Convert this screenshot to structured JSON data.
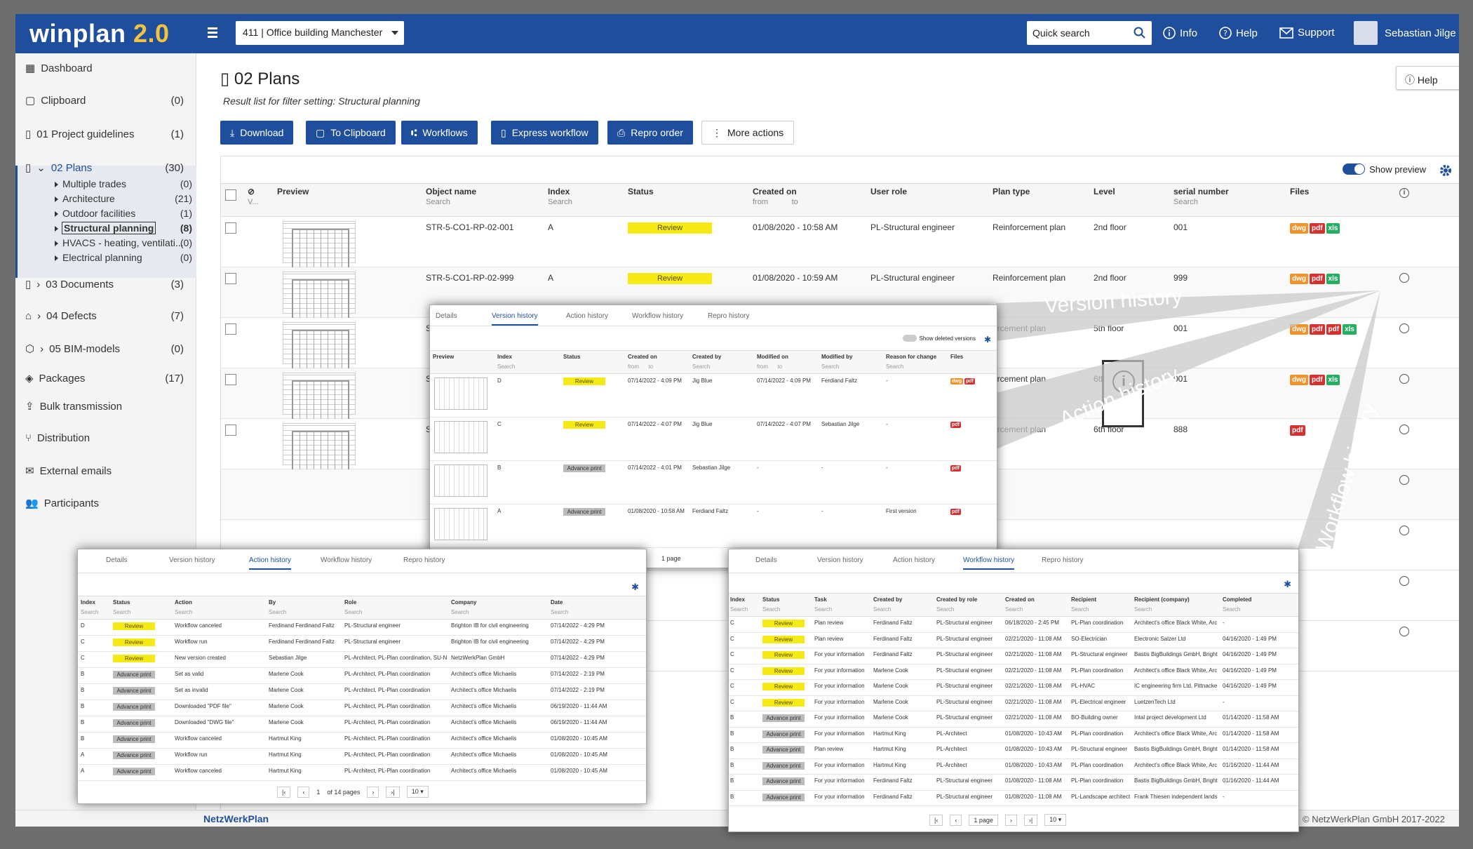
{
  "topbar": {
    "logo_main": "winplan",
    "logo_version": "2.0",
    "project": "411 | Office building Manchester",
    "search_placeholder": "Quick search",
    "info": "Info",
    "help": "Help",
    "support": "Support",
    "user": "Sebastian Jilge"
  },
  "sidebar": {
    "items": [
      {
        "label": "Dashboard",
        "count": ""
      },
      {
        "label": "Clipboard",
        "count": "(0)"
      },
      {
        "label": "01 Project guidelines",
        "count": "(1)"
      },
      {
        "label": "02 Plans",
        "count": "(30)"
      },
      {
        "label": "03 Documents",
        "count": "(3)"
      },
      {
        "label": "04 Defects",
        "count": "(7)"
      },
      {
        "label": "05 BIM-models",
        "count": "(0)"
      },
      {
        "label": "Packages",
        "count": "(17)"
      },
      {
        "label": "Bulk transmission",
        "count": ""
      },
      {
        "label": "Distribution",
        "count": ""
      },
      {
        "label": "External emails",
        "count": ""
      },
      {
        "label": "Participants",
        "count": ""
      }
    ],
    "plans_sub": [
      {
        "label": "Multiple trades",
        "count": "(0)"
      },
      {
        "label": "Architecture",
        "count": "(21)"
      },
      {
        "label": "Outdoor facilities",
        "count": "(1)"
      },
      {
        "label": "Structural planning",
        "count": "(8)"
      },
      {
        "label": "HVACS - heating, ventilati...",
        "count": "(0)"
      },
      {
        "label": "Electrical planning",
        "count": "(0)"
      }
    ]
  },
  "page": {
    "title": "02 Plans",
    "subtitle": "Result list for filter setting: Structural planning",
    "help": "Help"
  },
  "toolbar": {
    "download": "Download",
    "clipboard": "To Clipboard",
    "workflows": "Workflows",
    "express": "Express workflow",
    "repro": "Repro order",
    "more": "More actions"
  },
  "grid": {
    "show_preview": "Show preview",
    "headers": {
      "preview": "Preview",
      "object": "Object name",
      "index": "Index",
      "status": "Status",
      "created": "Created on",
      "role": "User role",
      "type": "Plan type",
      "level": "Level",
      "serial": "serial number",
      "files": "Files"
    },
    "search": "Search",
    "from": "from",
    "to": "to",
    "v": "V...",
    "rows": [
      {
        "object": "STR-5-CO1-RP-02-001",
        "index": "A",
        "status": "Review",
        "created": "01/08/2020 - 10:58 AM",
        "role": "PL-Structural engineer",
        "type": "Reinforcement plan",
        "level": "2nd floor",
        "serial": "001",
        "files": [
          "dwg",
          "pdf",
          "xls"
        ]
      },
      {
        "object": "STR-5-CO1-RP-02-999",
        "index": "A",
        "status": "Review",
        "created": "01/08/2020 - 10:59 AM",
        "role": "PL-Structural engineer",
        "type": "Reinforcement plan",
        "level": "2nd floor",
        "serial": "999",
        "files": [
          "dwg",
          "pdf",
          "xls"
        ]
      },
      {
        "object": "STR-",
        "type": "orcement plan",
        "level": "5th floor",
        "serial": "001",
        "files": [
          "dwg",
          "pdf",
          "pdf",
          "xls"
        ]
      },
      {
        "object": "STR-",
        "type": "orcement plan",
        "level": "6th floor",
        "serial": "001",
        "files": [
          "dwg",
          "pdf",
          "xls"
        ]
      },
      {
        "object": "STR-",
        "type": "orcement plan",
        "level": "6th floor",
        "serial": "888",
        "files": [
          "pdf"
        ]
      }
    ],
    "adv_label": "Advance print"
  },
  "fan_labels": {
    "version": "Version history",
    "action": "Action history",
    "workflow": "Workflow history"
  },
  "tabs": [
    "Details",
    "Version history",
    "Action history",
    "Workflow history",
    "Repro history"
  ],
  "version_panel": {
    "show_deleted": "Show deleted versions",
    "headers": [
      "Preview",
      "Index",
      "Status",
      "Created on",
      "Created by",
      "Modified on",
      "Modified by",
      "Reason for change",
      "Files"
    ],
    "rows": [
      {
        "index": "D",
        "status": "Review",
        "created": "07/14/2022 - 4:09 PM",
        "by": "Jig Blue",
        "mod": "07/14/2022 - 4:09 PM",
        "modby": "Ferdiand Faltz",
        "reason": "-",
        "files": [
          "dwg",
          "pdf"
        ]
      },
      {
        "index": "C",
        "status": "Review",
        "created": "07/14/2022 - 4:07 PM",
        "by": "Jig Blue",
        "mod": "07/14/2022 - 4:07 PM",
        "modby": "Sebastian Jilge",
        "reason": "-",
        "files": [
          "pdf"
        ]
      },
      {
        "index": "B",
        "status": "Advance print",
        "created": "07/14/2022 - 4:01 PM",
        "by": "Sebastian Jilge",
        "mod": "-",
        "modby": "-",
        "reason": "-",
        "files": [
          "pdf"
        ]
      },
      {
        "index": "A",
        "status": "Advance print",
        "created": "01/08/2020 - 10:58 AM",
        "by": "Ferdiand Faltz",
        "mod": "-",
        "modby": "-",
        "reason": "First version",
        "files": [
          "pdf"
        ]
      }
    ],
    "pager": "1 page"
  },
  "action_panel": {
    "headers": [
      "Index",
      "Status",
      "Action",
      "By",
      "Role",
      "Company",
      "Date"
    ],
    "rows": [
      [
        "D",
        "Review",
        "Workflow canceled",
        "Ferdinand Ferdinand Faltz",
        "PL-Structural engineer",
        "Brighton IB for civil engineering",
        "07/14/2022 - 4:29 PM"
      ],
      [
        "C",
        "Review",
        "Workflow run",
        "Ferdinand Ferdinand Faltz",
        "PL-Structural engineer",
        "Brighton IB for civil engineering",
        "07/14/2022 - 4:29 PM"
      ],
      [
        "C",
        "Review",
        "New version created",
        "Sebastian Jilge",
        "PL-Architect, PL-Plan coordination, SU-N",
        "NetzWerkPlan GmbH",
        "07/14/2022 - 4:29 PM"
      ],
      [
        "B",
        "Advance print",
        "Set as valid",
        "Marlene Cook",
        "PL-Architect, PL-Plan coordination",
        "Architect's office Michaelis",
        "07/14/2022 - 2:19 PM"
      ],
      [
        "B",
        "Advance print",
        "Set as invalid",
        "Marlene Cook",
        "PL-Architect, PL-Plan coordination",
        "Architect's office Michaelis",
        "07/14/2022 - 2:19 PM"
      ],
      [
        "B",
        "Advance print",
        "Downloaded \"PDF file\"",
        "Marlene Cook",
        "PL-Architect, PL-Plan coordination",
        "Architect's office Michaelis",
        "06/19/2020 - 11:44 AM"
      ],
      [
        "B",
        "Advance print",
        "Downloaded \"DWG file\"",
        "Marlene Cook",
        "PL-Architect, PL-Plan coordination",
        "Architect's office Michaelis",
        "06/19/2020 - 11:44 AM"
      ],
      [
        "B",
        "Advance print",
        "Workflow canceled",
        "Hartmut King",
        "PL-Architect, PL-Plan coordination",
        "Architect's office Michaelis",
        "01/08/2020 - 10:45 AM"
      ],
      [
        "A",
        "Advance print",
        "Workflow run",
        "Hartmut King",
        "PL-Architect, PL-Plan coordination",
        "Architect's office Michaelis",
        "01/08/2020 - 10:45 AM"
      ],
      [
        "A",
        "Advance print",
        "Workflow canceled",
        "Hartmut King",
        "PL-Architect, PL-Plan coordination",
        "Architect's office Michaelis",
        "01/08/2020 - 10:45 AM"
      ]
    ],
    "pager": "1",
    "pager_of": "of 14 pages",
    "per_page": "10"
  },
  "workflow_panel": {
    "headers": [
      "Index",
      "Status",
      "Task",
      "Created by",
      "Created by role",
      "Created on",
      "Recipient",
      "Recipient (company)",
      "Completed"
    ],
    "rows": [
      [
        "C",
        "Review",
        "Plan review",
        "Ferdinand Faltz",
        "PL-Structural engineer",
        "06/18/2020 - 2:45 PM",
        "PL-Plan coordination",
        "Architect's office Black White, Arc",
        "-"
      ],
      [
        "C",
        "Review",
        "Plan review",
        "Ferdinand Faltz",
        "PL-Structural engineer",
        "02/21/2020 - 11:08 AM",
        "SO-Electrician",
        "Electronic Salzer Ltd",
        "04/16/2020 - 1:49 PM"
      ],
      [
        "C",
        "Review",
        "For your information",
        "Ferdinand Faltz",
        "PL-Structural engineer",
        "02/21/2020 - 11:08 AM",
        "PL-Structural engineer",
        "Bastis BigBuildings GmbH, Bright",
        "04/16/2020 - 1:49 PM"
      ],
      [
        "C",
        "Review",
        "For your information",
        "Marlene Cook",
        "PL-Structural engineer",
        "02/21/2020 - 11:08 AM",
        "PL-Plan coordination",
        "Architect's office Black White, Arc",
        "04/16/2020 - 1:49 PM"
      ],
      [
        "C",
        "Review",
        "For your information",
        "Marlene Cook",
        "PL-Structural engineer",
        "02/21/2020 - 11:08 AM",
        "PL-HVAC",
        "IC engineering firm Ltd, Pittnacke",
        "04/16/2020 - 1:49 PM"
      ],
      [
        "C",
        "Review",
        "For your information",
        "Marlene Cook",
        "PL-Structural engineer",
        "02/21/2020 - 11:08 AM",
        "PL-Electrical engineer",
        "LuetzenTech Ltd",
        "-"
      ],
      [
        "B",
        "Advance print",
        "For your information",
        "Marlene Cook",
        "PL-Structural engineer",
        "02/21/2020 - 11:08 AM",
        "BO-Building owner",
        "Intal project development Ltd",
        "01/14/2020 - 11:58 AM"
      ],
      [
        "B",
        "Advance print",
        "For your information",
        "Hartmut King",
        "PL-Architect",
        "01/08/2020 - 10:43 AM",
        "PL-Plan coordination",
        "Architect's office Black White, Arc",
        "01/14/2020 - 11:58 AM"
      ],
      [
        "B",
        "Advance print",
        "Plan review",
        "Hartmut King",
        "PL-Architect",
        "01/08/2020 - 10:43 AM",
        "PL-Structural engineer",
        "Bastis BigBuildings GmbH, Bright",
        "01/14/2020 - 11:58 AM"
      ],
      [
        "B",
        "Advance print",
        "For your information",
        "Hartmut King",
        "PL-Architect",
        "01/08/2020 - 10:43 AM",
        "PL-Plan coordination",
        "Architect's office Black White, Arc",
        "01/16/2020 - 11:44 AM"
      ],
      [
        "B",
        "Advance print",
        "For your information",
        "Ferdinand Faltz",
        "PL-Structural engineer",
        "01/08/2020 - 11:08 AM",
        "PL-Plan coordination",
        "Bastis BigBuildings GmbH, Bright",
        "01/16/2020 - 11:44 AM"
      ],
      [
        "B",
        "Advance print",
        "For your information",
        "Ferdinand Faltz",
        "PL-Structural engineer",
        "01/08/2020 - 11:08 AM",
        "PL-Landscape architect",
        "Frank Thiesen independent lands",
        "-"
      ]
    ],
    "pager": "1 page",
    "per_page": "10"
  },
  "footer": {
    "logo": "NetzWerkPlan",
    "copyright": "© NetzWerkPlan GmbH 2017-2022"
  }
}
